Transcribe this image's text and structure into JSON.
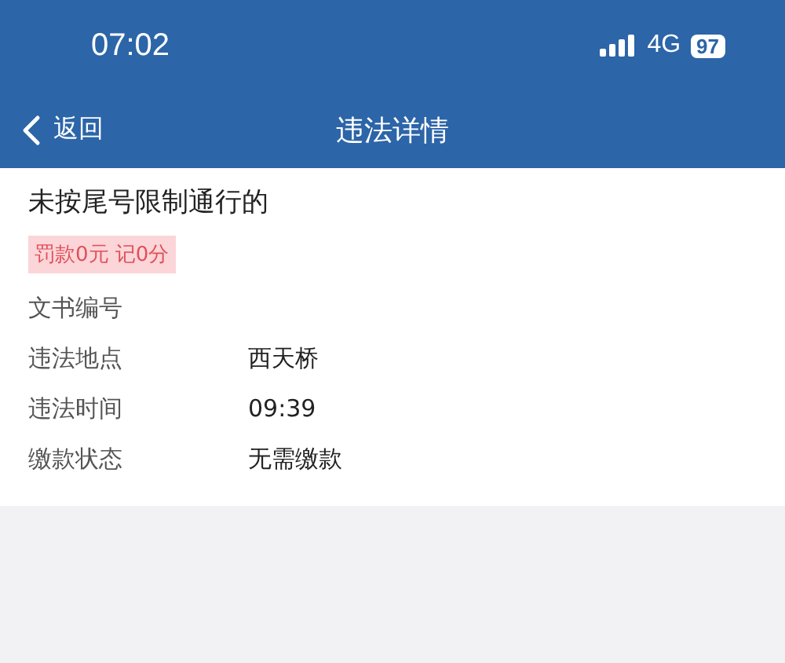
{
  "status_bar": {
    "time": "07:02",
    "network": "4G",
    "battery": "97"
  },
  "nav_bar": {
    "back": "返回",
    "title": "违法详情"
  },
  "violation": {
    "title": "未按尾号限制通行的",
    "penalty": "罚款0元 记0分"
  },
  "details": [
    {
      "label": "文书编号"
    },
    {
      "label": "违法地点",
      "value": "西天桥"
    },
    {
      "label": "违法时间",
      "value": "09:39"
    },
    {
      "label": "缴款状态",
      "value": "无需缴款"
    }
  ]
}
